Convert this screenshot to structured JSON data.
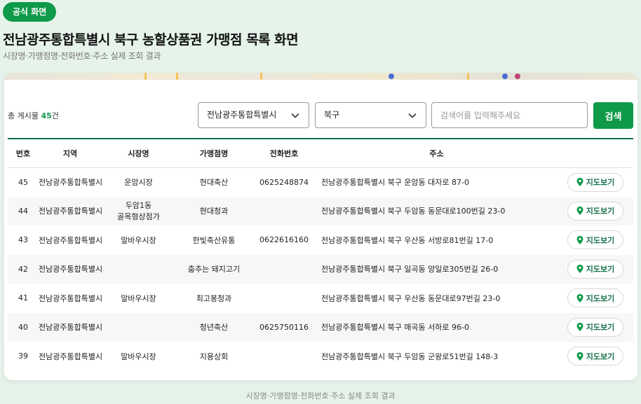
{
  "badge": "공식 화면",
  "page_title": "전남광주통합특별시 북구 농할상품권 가맹점 목록 화면",
  "page_subtitle": "시장명·가맹점명·전화번호·주소 실제 조회 결과",
  "toolbar": {
    "total_prefix": "총 게시물",
    "total_count": "45",
    "total_suffix": "건",
    "region_select": "전남광주통합특별시",
    "district_select": "북구",
    "search_placeholder": "검색어를 입력해주세요",
    "search_button": "검색"
  },
  "table": {
    "headers": [
      "번호",
      "지역",
      "시장명",
      "가맹점명",
      "전화번호",
      "주소",
      ""
    ],
    "rows": [
      {
        "no": "45",
        "region": "전남광주통합특별시",
        "market": "운암시장",
        "store": "현대축산",
        "phone": "0625248874",
        "address": "전남광주통합특별시 북구 운암동 대자로 87-0"
      },
      {
        "no": "44",
        "region": "전남광주통합특별시",
        "market": "두암1동\n골목형상점가",
        "store": "현대청과",
        "phone": "",
        "address": "전남광주통합특별시 북구 두암동 동문대로100번길 23-0"
      },
      {
        "no": "43",
        "region": "전남광주통합특별시",
        "market": "말바우시장",
        "store": "한빛축산유통",
        "phone": "0622616160",
        "address": "전남광주통합특별시 북구 우산동 서방로81번길 17-0"
      },
      {
        "no": "42",
        "region": "전남광주통합특별시",
        "market": "",
        "store": "춤추는 돼지고기",
        "phone": "",
        "address": "전남광주통합특별시 북구 일곡동 양일로305번길 26-0"
      },
      {
        "no": "41",
        "region": "전남광주통합특별시",
        "market": "말바우시장",
        "store": "최고봉청과",
        "phone": "",
        "address": "전남광주통합특별시 북구 우산동 동문대로97번길 23-0"
      },
      {
        "no": "40",
        "region": "전남광주통합특별시",
        "market": "",
        "store": "청년축산",
        "phone": "0625750116",
        "address": "전남광주통합특별시 북구 매곡동 서하로 96-0"
      },
      {
        "no": "39",
        "region": "전남광주통합특별시",
        "market": "말바우시장",
        "store": "지용상회",
        "phone": "",
        "address": "전남광주통합특별시 북구 두암동 군왕로51번길 148-3"
      }
    ],
    "map_button_label": "지도보기",
    "map_button_icon": "map-pin-icon"
  },
  "footer_note": "시장명·가맹점명·전화번호·주소 실제 조회 결과",
  "colors": {
    "accent": "#0f9a4a",
    "rule": "#15704a",
    "background": "#e6f3ea"
  }
}
